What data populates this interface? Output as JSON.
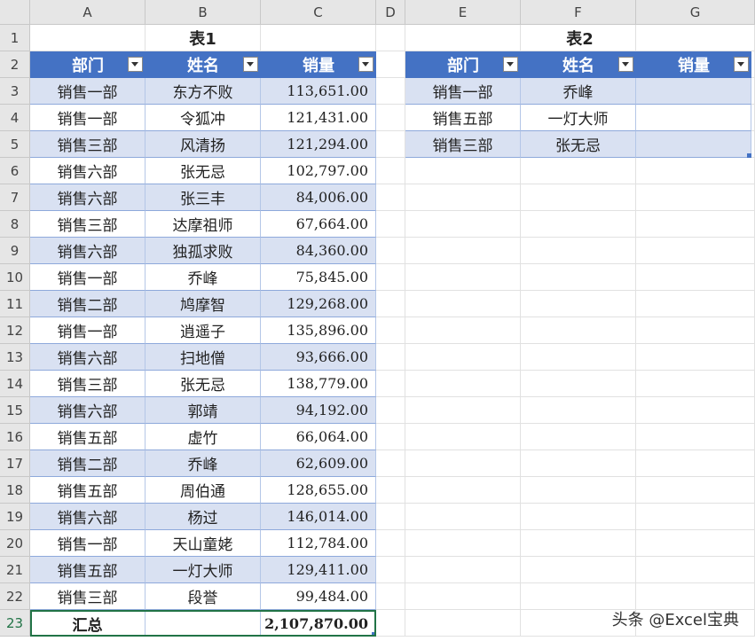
{
  "columns": [
    "A",
    "B",
    "C",
    "D",
    "E",
    "F",
    "G"
  ],
  "rows": [
    "1",
    "2",
    "3",
    "4",
    "5",
    "6",
    "7",
    "8",
    "9",
    "10",
    "11",
    "12",
    "13",
    "14",
    "15",
    "16",
    "17",
    "18",
    "19",
    "20",
    "21",
    "22",
    "23"
  ],
  "table1": {
    "title": "表1",
    "headers": [
      "部门",
      "姓名",
      "销量"
    ],
    "rows": [
      [
        "销售一部",
        "东方不败",
        "113,651.00"
      ],
      [
        "销售一部",
        "令狐冲",
        "121,431.00"
      ],
      [
        "销售三部",
        "风清扬",
        "121,294.00"
      ],
      [
        "销售六部",
        "张无忌",
        "102,797.00"
      ],
      [
        "销售六部",
        "张三丰",
        "84,006.00"
      ],
      [
        "销售三部",
        "达摩祖师",
        "67,664.00"
      ],
      [
        "销售六部",
        "独孤求败",
        "84,360.00"
      ],
      [
        "销售一部",
        "乔峰",
        "75,845.00"
      ],
      [
        "销售二部",
        "鸠摩智",
        "129,268.00"
      ],
      [
        "销售一部",
        "逍遥子",
        "135,896.00"
      ],
      [
        "销售六部",
        "扫地僧",
        "93,666.00"
      ],
      [
        "销售三部",
        "张无忌",
        "138,779.00"
      ],
      [
        "销售六部",
        "郭靖",
        "94,192.00"
      ],
      [
        "销售五部",
        "虚竹",
        "66,064.00"
      ],
      [
        "销售二部",
        "乔峰",
        "62,609.00"
      ],
      [
        "销售五部",
        "周伯通",
        "128,655.00"
      ],
      [
        "销售六部",
        "杨过",
        "146,014.00"
      ],
      [
        "销售一部",
        "天山童姥",
        "112,784.00"
      ],
      [
        "销售五部",
        "一灯大师",
        "129,411.00"
      ],
      [
        "销售三部",
        "段誉",
        "99,484.00"
      ]
    ],
    "total_label": "汇总",
    "total_value": "2,107,870.00"
  },
  "table2": {
    "title": "表2",
    "headers": [
      "部门",
      "姓名",
      "销量"
    ],
    "rows": [
      [
        "销售一部",
        "乔峰",
        ""
      ],
      [
        "销售五部",
        "一灯大师",
        ""
      ],
      [
        "销售三部",
        "张无忌",
        ""
      ]
    ]
  },
  "watermark": "头条 @Excel宝典",
  "colors": {
    "header_blue": "#4472c4",
    "band": "#d9e1f2",
    "selection": "#217346"
  }
}
